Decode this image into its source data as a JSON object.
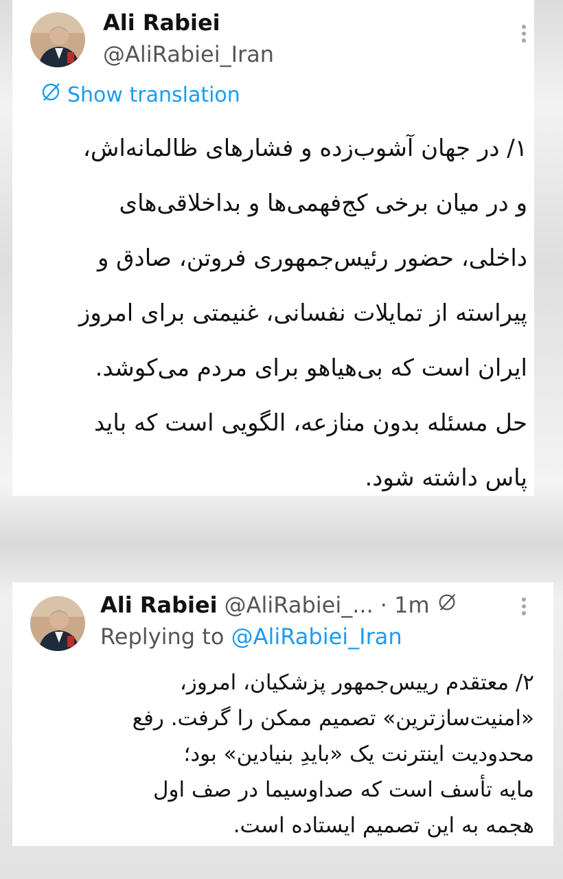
{
  "tweet1": {
    "display_name": "Ali Rabiei",
    "handle": "@AliRabiei_Iran",
    "translation_label": "Show translation",
    "lines": [
      "۱/ در جهان آشوب‌زده و فشارهای ظالمانه‌اش،",
      "و در میان برخی کج‌فهمی‌ها و بداخلاقی‌های",
      "داخلی، حضور رئیس‌جمهوری فروتن، صادق و",
      "پیراسته از تمایلات نفسانی، غنیمتی برای امروز",
      "ایران است که بی‌هیاهو برای مردم می‌کوشد.",
      "حل مسئله بدون منازعه، الگویی است که باید",
      "پاس داشته شود."
    ]
  },
  "tweet2": {
    "display_name": "Ali Rabiei",
    "handle": "@AliRabiei_...",
    "time": "· 1m",
    "reply_prefix": "Replying to",
    "reply_handle": "@AliRabiei_Iran",
    "lines": [
      "۲/ معتقدم رییس‌جمهور پزشکیان، امروز،",
      "«امنیت‌سازترین» تصمیم ممکن را گرفت. رفع",
      "محدودیت اینترنت یک «بایدِ بنیادین» بود؛",
      "مایه تأسف است که صداوسیما در صف اول",
      "هجمه به این تصمیم ایستاده است."
    ]
  },
  "icons": {
    "more": "more-vertical-icon",
    "translate": "translate-slash-icon"
  },
  "colors": {
    "link": "#1d9bf0",
    "text": "#111111",
    "secondary": "#555555"
  }
}
